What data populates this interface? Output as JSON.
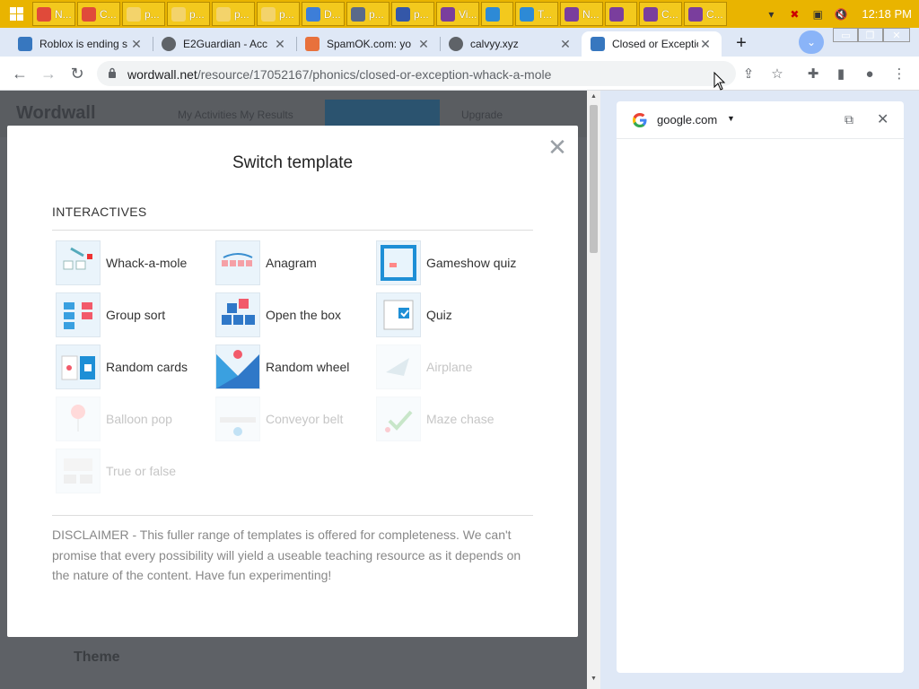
{
  "taskbar": {
    "items": [
      {
        "label": "N...",
        "icon": "chrome-icon"
      },
      {
        "label": "C...",
        "icon": "chrome-icon"
      },
      {
        "label": "p...",
        "icon": "folder-icon"
      },
      {
        "label": "p...",
        "icon": "folder-icon"
      },
      {
        "label": "p...",
        "icon": "folder-icon"
      },
      {
        "label": "p...",
        "icon": "folder-icon"
      },
      {
        "label": "D...",
        "icon": "download-folder-icon"
      },
      {
        "label": "p...",
        "icon": "window-icon"
      },
      {
        "label": "p...",
        "icon": "document-icon"
      },
      {
        "label": "Vi...",
        "icon": "app-icon"
      },
      {
        "label": "",
        "icon": "ie-icon"
      },
      {
        "label": "T...",
        "icon": "ie-icon"
      },
      {
        "label": "N...",
        "icon": "app-icon"
      },
      {
        "label": "",
        "icon": "app-icon"
      },
      {
        "label": "C...",
        "icon": "app-icon"
      },
      {
        "label": "C...",
        "icon": "app-icon"
      }
    ],
    "clock": "12:18 PM"
  },
  "browser": {
    "tabs": [
      {
        "title": "Roblox is ending s",
        "icon": "wordwall-icon"
      },
      {
        "title": "E2Guardian - Acc",
        "icon": "globe-icon"
      },
      {
        "title": "SpamOK.com: yo",
        "icon": "spamok-icon"
      },
      {
        "title": "calvyy.xyz",
        "icon": "globe-icon"
      },
      {
        "title": "Closed or Exceptio",
        "icon": "wordwall-icon",
        "active": true
      }
    ],
    "url_host": "wordwall.net",
    "url_path": "/resource/17052167/phonics/closed-or-exception-whack-a-mole"
  },
  "page": {
    "logo": "Wordwall",
    "nav": "My Activities   My Results",
    "upgrade": "Upgrade",
    "theme_heading": "Theme"
  },
  "modal": {
    "title": "Switch template",
    "section": "INTERACTIVES",
    "templates": [
      {
        "name": "Whack-a-mole",
        "enabled": true
      },
      {
        "name": "Anagram",
        "enabled": true
      },
      {
        "name": "Gameshow quiz",
        "enabled": true
      },
      {
        "name": "Group sort",
        "enabled": true
      },
      {
        "name": "Open the box",
        "enabled": true
      },
      {
        "name": "Quiz",
        "enabled": true
      },
      {
        "name": "Random cards",
        "enabled": true
      },
      {
        "name": "Random wheel",
        "enabled": true
      },
      {
        "name": "Airplane",
        "enabled": false
      },
      {
        "name": "Balloon pop",
        "enabled": false
      },
      {
        "name": "Conveyor belt",
        "enabled": false
      },
      {
        "name": "Maze chase",
        "enabled": false
      },
      {
        "name": "True or false",
        "enabled": false
      }
    ],
    "disclaimer": "DISCLAIMER - This fuller range of templates is offered for completeness. We can't promise that every possibility will yield a useable teaching resource as it depends on the nature of the content. Have fun experimenting!"
  },
  "side_panel": {
    "site": "google.com"
  },
  "colors": {
    "taskbar": "#e9b400",
    "chrome_frame": "#dfe8f6",
    "overlay": "#5e6166",
    "accent": "#2e8fd6"
  }
}
